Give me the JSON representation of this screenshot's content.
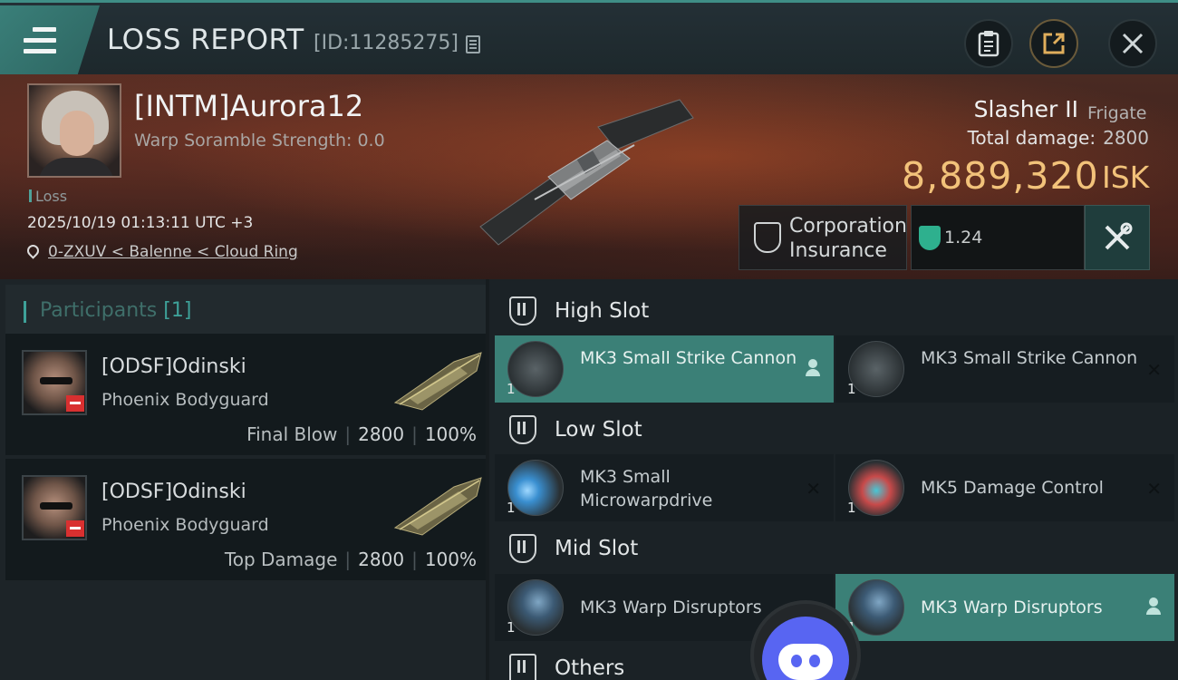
{
  "topbar": {
    "title": "LOSS REPORT",
    "report_id": "[ID:11285275]"
  },
  "victim": {
    "name": "[INTM]Aurora12",
    "warp_scramble": "Warp Soramble Strength: 0.0",
    "loss_label": "Loss",
    "timestamp": "2025/10/19 01:13:11 UTC +3",
    "location": "0-ZXUV < Balenne < Cloud Ring",
    "ship_name": "Slasher II",
    "ship_class": "Frigate",
    "total_damage_label": "Total damage:",
    "total_damage_value": "2800",
    "isk_value": "8,889,320",
    "isk_unit": "ISK",
    "insurance_label": "Corporation Insurance",
    "insurance_rate": "1.24"
  },
  "participants": {
    "title": "Participants",
    "count": "[1]",
    "items": [
      {
        "name": "[ODSF]Odinski",
        "ship": "Phoenix Bodyguard",
        "role": "Final Blow",
        "damage": "2800",
        "percent": "100%"
      },
      {
        "name": "[ODSF]Odinski",
        "ship": "Phoenix Bodyguard",
        "role": "Top Damage",
        "damage": "2800",
        "percent": "100%"
      }
    ]
  },
  "slots": {
    "high": {
      "title": "High Slot",
      "modules": [
        {
          "name": "MK3 Small Strike Cannon",
          "qty": "1",
          "status": "pilot"
        },
        {
          "name": "MK3 Small Strike Cannon",
          "qty": "1",
          "status": "dropped"
        }
      ]
    },
    "low": {
      "title": "Low Slot",
      "modules": [
        {
          "name": "MK3 Small Microwarpdrive",
          "qty": "1",
          "status": "dropped"
        },
        {
          "name": "MK5 Damage Control",
          "qty": "1",
          "status": "dropped"
        }
      ]
    },
    "mid": {
      "title": "Mid Slot",
      "modules": [
        {
          "name": "MK3 Warp Disruptors",
          "qty": "1",
          "status": "dropped"
        },
        {
          "name": "MK3 Warp Disruptors",
          "qty": "1",
          "status": "pilot"
        }
      ]
    },
    "others": {
      "title": "Others"
    }
  },
  "icons": {
    "menu": "menu-icon",
    "copy": "copy-icon",
    "clipboard": "clipboard-icon",
    "share": "share-icon",
    "close": "close-icon",
    "location": "location-pin-icon",
    "insurance": "insurance-shield-icon",
    "fitting": "tools-icon",
    "discord": "discord-icon"
  },
  "colors": {
    "accent": "#3ea199",
    "isk": "#f2c27a",
    "highlight_row": "#3b8077",
    "danger_badge": "#d93030"
  }
}
